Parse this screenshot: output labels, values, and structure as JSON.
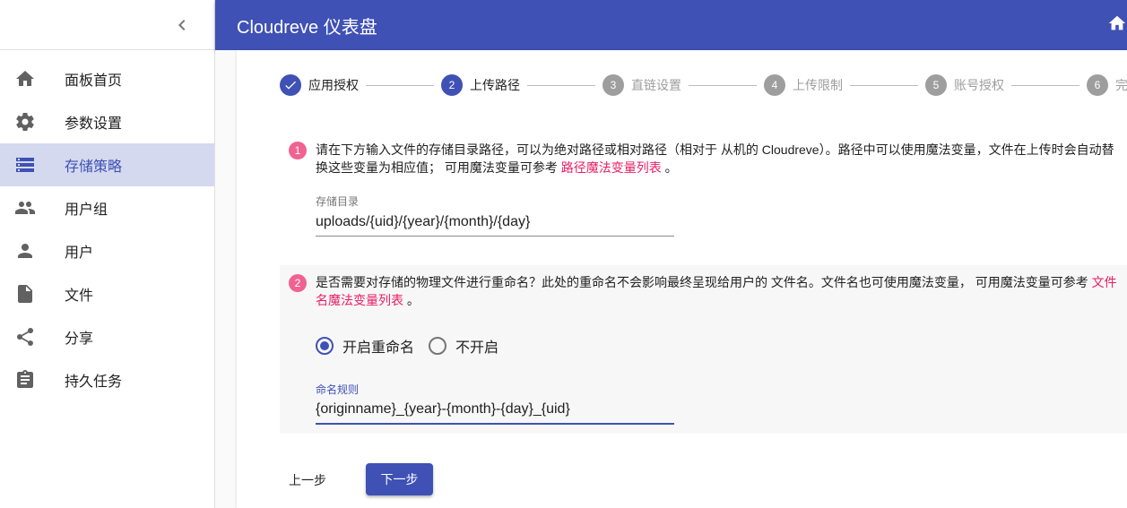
{
  "app": {
    "title": "Cloudreve 仪表盘"
  },
  "sidebar": {
    "items": [
      {
        "label": "面板首页",
        "icon": "home-icon"
      },
      {
        "label": "参数设置",
        "icon": "gear-icon"
      },
      {
        "label": "存储策略",
        "icon": "storage-icon",
        "active": true
      },
      {
        "label": "用户组",
        "icon": "group-icon"
      },
      {
        "label": "用户",
        "icon": "person-icon"
      },
      {
        "label": "文件",
        "icon": "file-icon"
      },
      {
        "label": "分享",
        "icon": "share-icon"
      },
      {
        "label": "持久任务",
        "icon": "clipboard-icon"
      }
    ]
  },
  "stepper": {
    "steps": [
      {
        "num": "1",
        "label": "应用授权",
        "state": "done"
      },
      {
        "num": "2",
        "label": "上传路径",
        "state": "current"
      },
      {
        "num": "3",
        "label": "直链设置",
        "state": "pending"
      },
      {
        "num": "4",
        "label": "上传限制",
        "state": "pending"
      },
      {
        "num": "5",
        "label": "账号授权",
        "state": "pending"
      },
      {
        "num": "6",
        "label": "完",
        "state": "pending"
      }
    ]
  },
  "section1": {
    "badge": "1",
    "text_line1": "请在下方输入文件的存储目录路径，可以为绝对路径或相对路径（相对于 从机的 Cloudreve）。路径中可以使用魔法变量，文件在上传时会自动替",
    "text_line2": "换这些变量为相应值； 可用魔法变量可参考 ",
    "link": "路径魔法变量列表",
    "text_end": " 。",
    "field_label": "存储目录",
    "field_value": "uploads/{uid}/{year}/{month}/{day}"
  },
  "section2": {
    "badge": "2",
    "text_line1": "是否需要对存储的物理文件进行重命名？此处的重命名不会影响最终呈现给用户的 文件名。文件名也可使用魔法变量， 可用魔法变量可参考 ",
    "link_part1": "文件",
    "link_part2": "名魔法变量列表",
    "text_end": " 。",
    "radio_on": "开启重命名",
    "radio_off": "不开启",
    "field_label": "命名规则",
    "field_value": "{originname}_{year}-{month}-{day}_{uid}"
  },
  "buttons": {
    "back": "上一步",
    "next": "下一步"
  },
  "colors": {
    "primary": "#3f51b5",
    "accent": "#f06292",
    "link": "#e91e63"
  }
}
